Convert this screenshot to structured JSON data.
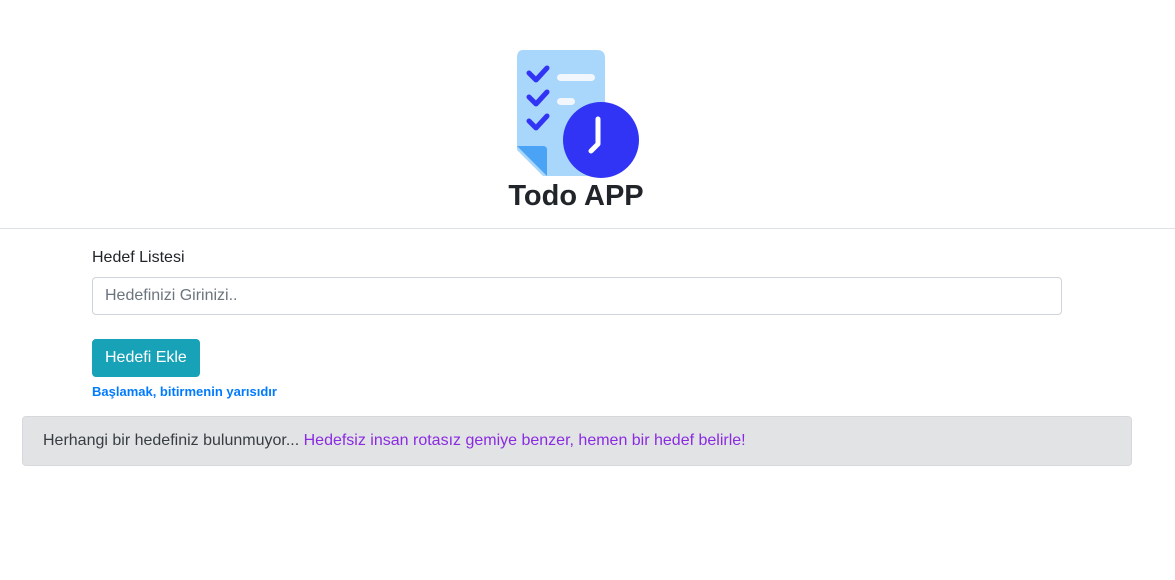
{
  "header": {
    "title": "Todo APP",
    "logo_icon": "checklist-clock-icon"
  },
  "form": {
    "label": "Hedef Listesi",
    "input_value": "",
    "input_placeholder": "Hedefinizi Girinizi..",
    "add_button_label": "Hedefi Ekle",
    "motto": "Başlamak, bitirmenin yarısıdır"
  },
  "alert": {
    "message": "Herhangi bir hedefiniz bulunmuyor...",
    "highlight": "Hedefsiz insan rotasız gemiye benzer, hemen bir hedef belirle!"
  },
  "colors": {
    "accent": "#17a2b8",
    "motto": "#007bff",
    "highlight": "#8a2be2",
    "logo_primary": "#3134f5",
    "logo_paper": "#a9d6fb"
  }
}
